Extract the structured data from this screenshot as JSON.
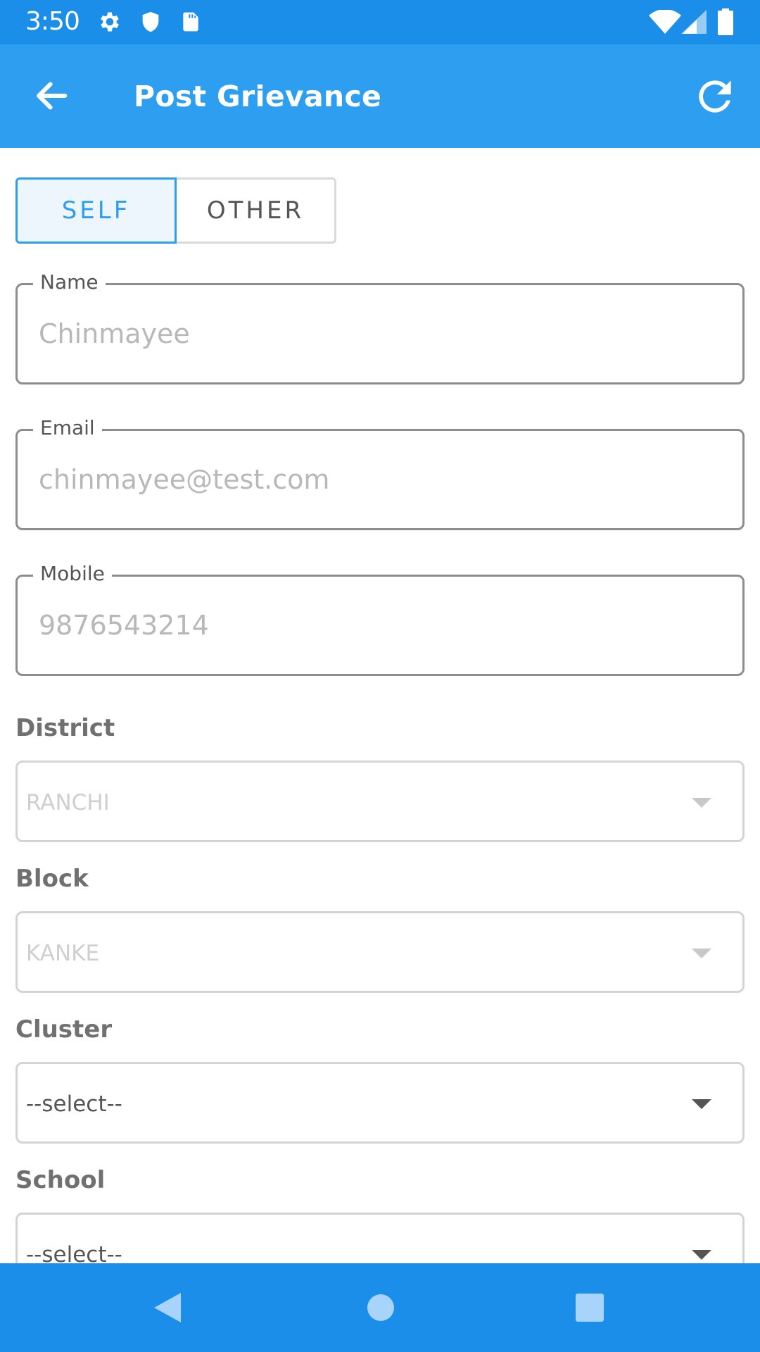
{
  "status_bar": {
    "time": "3:50",
    "left_icons": [
      "settings-icon",
      "shield-icon",
      "sd-card-icon"
    ],
    "right_icons": [
      "wifi-icon",
      "signal-icon",
      "battery-icon"
    ]
  },
  "app_bar": {
    "title": "Post Grievance",
    "back_icon": "arrow-left-icon",
    "refresh_icon": "refresh-icon"
  },
  "toggle": {
    "self_label": "SELF",
    "other_label": "OTHER",
    "selected": "SELF"
  },
  "fields": {
    "name": {
      "label": "Name",
      "value": "Chinmayee"
    },
    "email": {
      "label": "Email",
      "value": "chinmayee@test.com"
    },
    "mobile": {
      "label": "Mobile",
      "value": "9876543214"
    }
  },
  "selects": {
    "district": {
      "label": "District",
      "value": "RANCHI"
    },
    "block": {
      "label": "Block",
      "value": "KANKE"
    },
    "cluster": {
      "label": "Cluster",
      "value": "--select--"
    },
    "school": {
      "label": "School",
      "value": "--select--"
    }
  },
  "nav_bar": {
    "icons": [
      "nav-back-icon",
      "nav-home-icon",
      "nav-recents-icon"
    ]
  },
  "colors": {
    "status_bar": "#1a8ee8",
    "app_bar": "#2e9ff0",
    "accent": "#2e9ff0"
  }
}
